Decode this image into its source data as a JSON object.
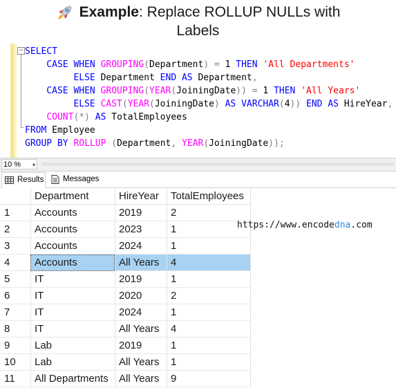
{
  "header": {
    "line1_bold": "Example",
    "line1_rest": ": Replace ROLLUP NULLs with",
    "line2": "Labels",
    "icon": "rocket-icon"
  },
  "editor": {
    "fold_glyph": "−",
    "lines": [
      [
        {
          "t": "SELECT",
          "c": "kw"
        }
      ],
      [
        {
          "t": "    CASE WHEN ",
          "c": "kw"
        },
        {
          "t": "GROUPING",
          "c": "fn"
        },
        {
          "t": "(",
          "c": "op"
        },
        {
          "t": "Department",
          "c": ""
        },
        {
          "t": ")",
          "c": "op"
        },
        {
          "t": " ",
          "c": ""
        },
        {
          "t": "=",
          "c": "op"
        },
        {
          "t": " 1 ",
          "c": ""
        },
        {
          "t": "THEN ",
          "c": "kw"
        },
        {
          "t": "'All Departments'",
          "c": "str"
        }
      ],
      [
        {
          "t": "         ELSE ",
          "c": "kw"
        },
        {
          "t": "Department ",
          "c": ""
        },
        {
          "t": "END AS ",
          "c": "kw"
        },
        {
          "t": "Department",
          "c": ""
        },
        {
          "t": ",",
          "c": "op"
        }
      ],
      [
        {
          "t": "    CASE WHEN ",
          "c": "kw"
        },
        {
          "t": "GROUPING",
          "c": "fn"
        },
        {
          "t": "(",
          "c": "op"
        },
        {
          "t": "YEAR",
          "c": "fn"
        },
        {
          "t": "(",
          "c": "op"
        },
        {
          "t": "JoiningDate",
          "c": ""
        },
        {
          "t": "))",
          "c": "op"
        },
        {
          "t": " ",
          "c": ""
        },
        {
          "t": "=",
          "c": "op"
        },
        {
          "t": " 1 ",
          "c": ""
        },
        {
          "t": "THEN ",
          "c": "kw"
        },
        {
          "t": "'All Years'",
          "c": "str"
        }
      ],
      [
        {
          "t": "         ELSE ",
          "c": "kw"
        },
        {
          "t": "CAST",
          "c": "fn"
        },
        {
          "t": "(",
          "c": "op"
        },
        {
          "t": "YEAR",
          "c": "fn"
        },
        {
          "t": "(",
          "c": "op"
        },
        {
          "t": "JoiningDate",
          "c": ""
        },
        {
          "t": ")",
          "c": "op"
        },
        {
          "t": " AS ",
          "c": "kw"
        },
        {
          "t": "VARCHAR",
          "c": "kw"
        },
        {
          "t": "(",
          "c": "op"
        },
        {
          "t": "4",
          "c": ""
        },
        {
          "t": "))",
          "c": "op"
        },
        {
          "t": " END AS ",
          "c": "kw"
        },
        {
          "t": "HireYear",
          "c": ""
        },
        {
          "t": ",",
          "c": "op"
        }
      ],
      [
        {
          "t": "    ",
          "c": ""
        },
        {
          "t": "COUNT",
          "c": "fn"
        },
        {
          "t": "(",
          "c": "op"
        },
        {
          "t": "*",
          "c": "op"
        },
        {
          "t": ")",
          "c": "op"
        },
        {
          "t": " AS ",
          "c": "kw"
        },
        {
          "t": "TotalEmployees",
          "c": ""
        }
      ],
      [
        {
          "t": "FROM ",
          "c": "kw"
        },
        {
          "t": "Employee",
          "c": ""
        }
      ],
      [
        {
          "t": "GROUP BY ",
          "c": "kw"
        },
        {
          "t": "ROLLUP ",
          "c": "fn"
        },
        {
          "t": "(",
          "c": "op"
        },
        {
          "t": "Department",
          "c": ""
        },
        {
          "t": ",",
          "c": "op"
        },
        {
          "t": " ",
          "c": ""
        },
        {
          "t": "YEAR",
          "c": "fn"
        },
        {
          "t": "(",
          "c": "op"
        },
        {
          "t": "JoiningDate",
          "c": ""
        },
        {
          "t": "));",
          "c": "op"
        }
      ]
    ]
  },
  "statusbar": {
    "zoom": "10 %",
    "zoom_arrow": "▾"
  },
  "tabs": {
    "results": "Results",
    "messages": "Messages"
  },
  "grid": {
    "columns": [
      "",
      "Department",
      "HireYear",
      "TotalEmployees"
    ],
    "selected_row": 3,
    "rows": [
      [
        "1",
        "Accounts",
        "2019",
        "2"
      ],
      [
        "2",
        "Accounts",
        "2023",
        "1"
      ],
      [
        "3",
        "Accounts",
        "2024",
        "1"
      ],
      [
        "4",
        "Accounts",
        "All Years",
        "4"
      ],
      [
        "5",
        "IT",
        "2019",
        "1"
      ],
      [
        "6",
        "IT",
        "2020",
        "2"
      ],
      [
        "7",
        "IT",
        "2024",
        "1"
      ],
      [
        "8",
        "IT",
        "All Years",
        "4"
      ],
      [
        "9",
        "Lab",
        "2019",
        "1"
      ],
      [
        "10",
        "Lab",
        "All Years",
        "1"
      ],
      [
        "11",
        "All Departments",
        "All Years",
        "9"
      ]
    ]
  },
  "watermark": {
    "prefix": "https://www.encode",
    "accent": "dna",
    "suffix": ".com"
  },
  "colors": {
    "keyword": "#0000ff",
    "function": "#ff00ff",
    "string": "#ff0000",
    "operator": "#808080",
    "selection": "#a8d2f2",
    "watermark_accent": "#2e86d6"
  }
}
